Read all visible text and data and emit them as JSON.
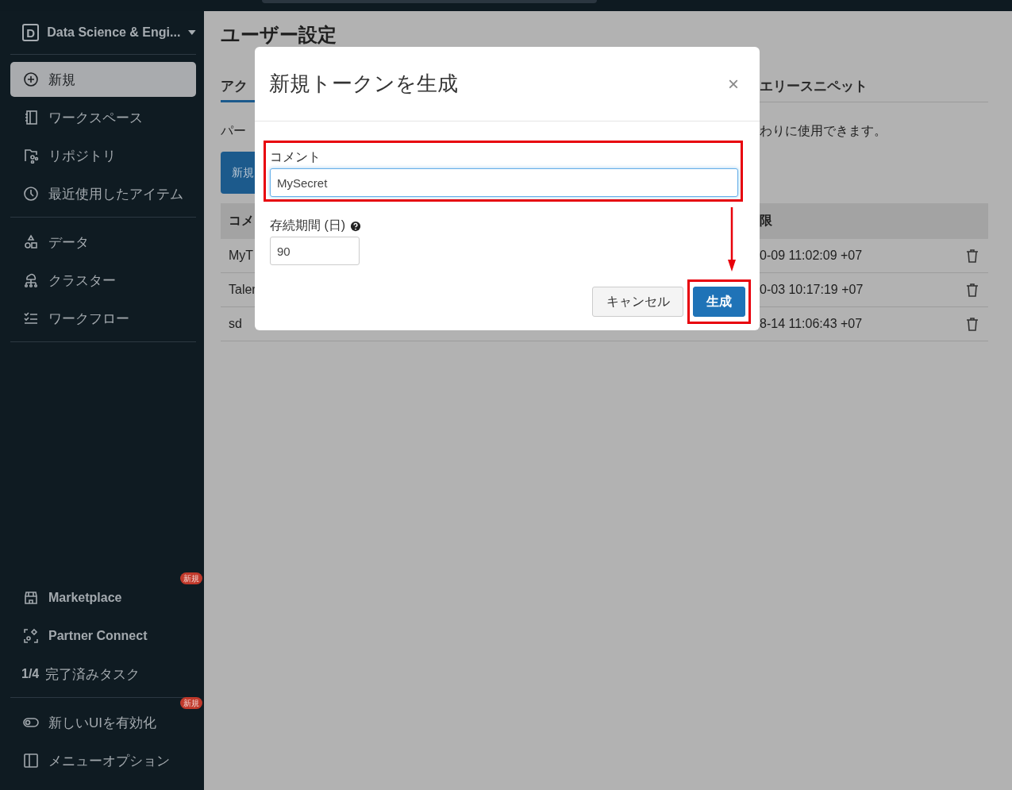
{
  "sidebar": {
    "workspace": {
      "letter": "D",
      "label": "Data Science & Engi..."
    },
    "sections": [
      {
        "items": [
          {
            "kind": "new",
            "label": "新規",
            "selected": true
          },
          {
            "kind": "workspace",
            "label": "ワークスペース",
            "selected": false
          },
          {
            "kind": "repos",
            "label": "リポジトリ",
            "selected": false
          },
          {
            "kind": "recent",
            "label": "最近使用したアイテム",
            "selected": false
          }
        ]
      },
      {
        "items": [
          {
            "kind": "data",
            "label": "データ",
            "selected": false
          },
          {
            "kind": "compute",
            "label": "クラスター",
            "selected": false
          },
          {
            "kind": "workflows",
            "label": "ワークフロー",
            "selected": false
          }
        ]
      }
    ],
    "footer": [
      {
        "items": [
          {
            "kind": "marketplace",
            "label": "Marketplace",
            "badge": "新規",
            "selected": false
          },
          {
            "kind": "partner",
            "label": "Partner Connect",
            "selected": false
          },
          {
            "kind": "tasks",
            "count": "1/4",
            "label": "完了済みタスク",
            "selected": false
          }
        ]
      },
      {
        "items": [
          {
            "kind": "newui",
            "label": "新しいUIを有効化",
            "badge": "新規",
            "selected": false
          },
          {
            "kind": "menu",
            "label": "メニューオプション",
            "selected": false
          }
        ]
      }
    ]
  },
  "page": {
    "title": "ユーザー設定",
    "tabs": [
      {
        "label": "アク",
        "selected": true
      },
      {
        "label": "エリースニペット",
        "selected": false
      }
    ],
    "description": [
      "パー",
      "わりに使用できます。"
    ],
    "new_button": "新規",
    "table": {
      "columns": [
        "コメ",
        "限"
      ],
      "rows": [
        [
          "MyT",
          "0-09 11:02:09 +07"
        ],
        [
          "Taler",
          "0-03 10:17:19 +07"
        ],
        [
          "sd",
          "8-14 11:06:43 +07"
        ]
      ]
    }
  },
  "dialog": {
    "title": "新規トークンを生成",
    "close": "×",
    "fields": [
      {
        "label": "コメント",
        "value": "MySecret",
        "focused": true,
        "highlighted": true,
        "help": false
      },
      {
        "label": "存続期間 (日)",
        "value": "90",
        "focused": false,
        "highlighted": false,
        "help": true
      }
    ],
    "buttons": [
      {
        "label": "キャンセル",
        "kind": "secondary",
        "highlighted": false
      },
      {
        "label": "生成",
        "kind": "primary",
        "highlighted": true
      }
    ],
    "arrow": true
  }
}
